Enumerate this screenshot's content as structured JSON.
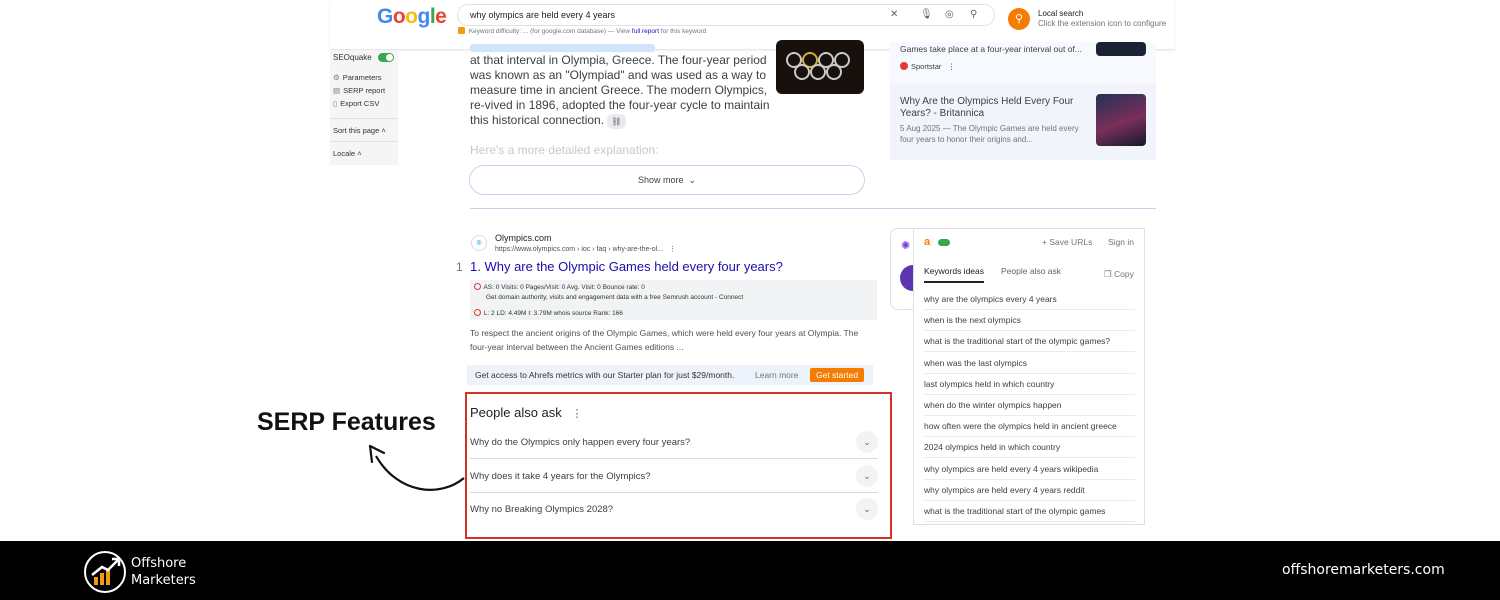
{
  "colors": {
    "accent_red": "#d93025",
    "link_blue": "#1a0dab",
    "ahrefs_orange": "#f57c00",
    "footer_bg": "#000000"
  },
  "google": {
    "logo_letters": [
      "G",
      "o",
      "o",
      "g",
      "l",
      "e"
    ],
    "logo_colors": [
      "#4285f4",
      "#ea4335",
      "#fbbc05",
      "#4285f4",
      "#34a853",
      "#ea4335"
    ],
    "search_query": "why olympics are held every 4 years",
    "kd_label": "Keyword difficulty: ...",
    "kd_db": "(for google.com database) — View",
    "kd_link": "full report",
    "kd_tail": "for this keyword",
    "ext_title": "Local search",
    "ext_subtitle": "Click the extension icon to configure"
  },
  "seoquake": {
    "title": "SEOquake",
    "items": [
      "Parameters",
      "SERP report",
      "Export CSV"
    ],
    "sort_label": "Sort this page",
    "locale_label": "Locale"
  },
  "ai_overview": {
    "paragraph": "at that interval in Olympia, Greece. The four-year period was known as an \"Olympiad\" and was used as a way to measure time in ancient Greece. The modern Olympics, re-vived in 1896, adopted the four-year cycle to maintain this historical connection.",
    "faded_line": "Here's a more detailed explanation:",
    "show_more": "Show more"
  },
  "right_column": {
    "top_title": "Games take place at a four-year interval out of...",
    "top_source": "Sportstar",
    "card_title": "Why Are the Olympics Held Every Four Years? - Britannica",
    "card_desc": "5 Aug 2025 — The Olympic Games are held every four years to honor their origins and..."
  },
  "result": {
    "site_name": "Olympics.com",
    "url": "https://www.olympics.com › ioc › faq › why-are-the-ol...",
    "rank": "1",
    "title": "1. Why are the Olympic Games held every four years?",
    "metrics_row1": "AS: 0     Visits: 0    Pages/Visit: 0    Avg. Visit: 0    Bounce rate: 0",
    "metrics_row2": "Get domain authority, visits and engagement data with a free Semrush account - Connect",
    "metrics_row3": "L: 2    LD: 4.49M    I: 3.79M    whois    source    Rank: 166",
    "snippet": "To respect the ancient origins of the Olympic Games, which were held every four years at Olympia. The four-year interval between the Ancient Games editions ..."
  },
  "ahrefs": {
    "text": "Get access to Ahrefs metrics with our Starter plan for just $29/month.",
    "learn_more": "Learn more",
    "get_started": "Get started"
  },
  "paa": {
    "title": "People also ask",
    "questions": [
      "Why do the Olympics only happen every four years?",
      "Why does it take 4 years for the Olympics?",
      "Why no Breaking Olympics 2028?"
    ]
  },
  "keywords_panel": {
    "logo": "a",
    "save_urls": "+ Save URLs",
    "sign_in": "Sign in",
    "tabs": [
      "Keywords ideas",
      "People also ask"
    ],
    "copy": "Copy",
    "items": [
      "why are the olympics every 4 years",
      "when is the next olympics",
      "what is the traditional start of the olympic games?",
      "when was the last olympics",
      "last olympics held in which country",
      "when do the winter olympics happen",
      "how often were the olympics held in ancient greece",
      "2024 olympics held in which country",
      "why olympics are held every 4 years wikipedia",
      "why olympics are held every 4 years reddit",
      "what is the traditional start of the olympic games"
    ]
  },
  "annotation": {
    "label": "SERP Features"
  },
  "footer": {
    "brand_line1": "Offshore",
    "brand_line2": "Marketers",
    "website": "offshoremarketers.com"
  }
}
